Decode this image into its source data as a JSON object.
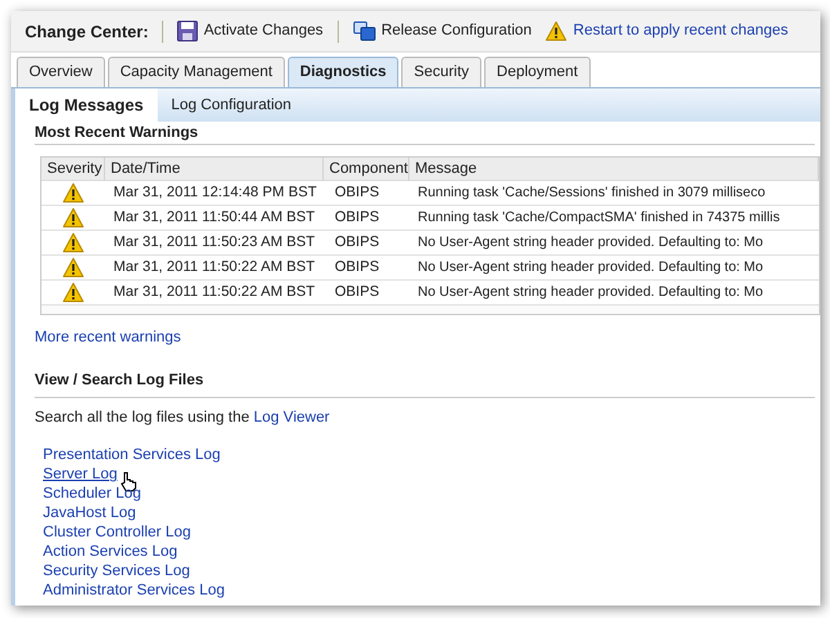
{
  "change_center": {
    "label": "Change Center:",
    "actions": [
      {
        "kind": "save",
        "label": "Activate Changes"
      },
      {
        "kind": "release",
        "label": "Release Configuration"
      },
      {
        "kind": "warning",
        "label": "Restart to apply recent changes"
      }
    ]
  },
  "tabs": [
    {
      "label": "Overview",
      "selected": false
    },
    {
      "label": "Capacity Management",
      "selected": false
    },
    {
      "label": "Diagnostics",
      "selected": true
    },
    {
      "label": "Security",
      "selected": false
    },
    {
      "label": "Deployment",
      "selected": false
    }
  ],
  "subtabs": [
    {
      "label": "Log Messages",
      "selected": true
    },
    {
      "label": "Log Configuration",
      "selected": false
    }
  ],
  "warnings": {
    "title": "Most Recent Warnings",
    "columns": [
      "Severity",
      "Date/Time",
      "Component",
      "Message"
    ],
    "rows": [
      {
        "datetime": "Mar 31, 2011 12:14:48 PM BST",
        "component": "OBIPS",
        "message": "Running task 'Cache/Sessions' finished in 3079 milliseco"
      },
      {
        "datetime": "Mar 31, 2011 11:50:44 AM BST",
        "component": "OBIPS",
        "message": "Running task 'Cache/CompactSMA' finished in 74375 millis"
      },
      {
        "datetime": "Mar 31, 2011 11:50:23 AM BST",
        "component": "OBIPS",
        "message": "No User-Agent string header provided. Defaulting to: Mo"
      },
      {
        "datetime": "Mar 31, 2011 11:50:22 AM BST",
        "component": "OBIPS",
        "message": "No User-Agent string header provided. Defaulting to: Mo"
      },
      {
        "datetime": "Mar 31, 2011 11:50:22 AM BST",
        "component": "OBIPS",
        "message": "No User-Agent string header provided. Defaulting to: Mo"
      }
    ],
    "more_link": "More recent warnings"
  },
  "log_files": {
    "title": "View / Search Log Files",
    "intro": "Search all the log files using the",
    "intro_link": "Log Viewer",
    "links": [
      {
        "label": "Presentation Services Log",
        "hovered": false
      },
      {
        "label": "Server Log",
        "hovered": true
      },
      {
        "label": "Scheduler Log",
        "hovered": false
      },
      {
        "label": "JavaHost Log",
        "hovered": false
      },
      {
        "label": "Cluster Controller Log",
        "hovered": false
      },
      {
        "label": "Action Services Log",
        "hovered": false
      },
      {
        "label": "Security Services Log",
        "hovered": false
      },
      {
        "label": "Administrator Services Log",
        "hovered": false
      }
    ]
  }
}
